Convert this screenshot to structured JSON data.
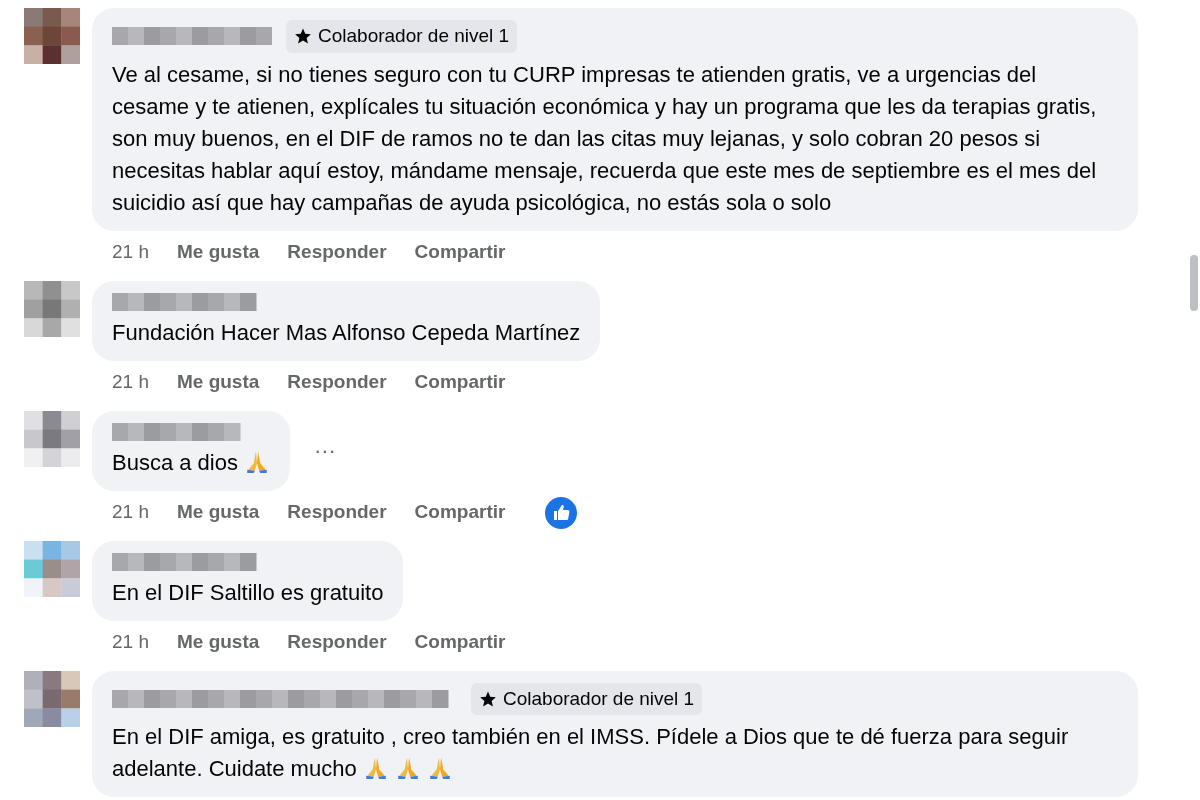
{
  "comments": [
    {
      "badge": {
        "label": "Colaborador de nivel 1"
      },
      "text": "Ve al cesame, si no tienes seguro con tu CURP impresas te atienden gratis, ve a urgencias del cesame y te atienen, explícales tu situación económica y hay un programa que les da terapias gratis, son muy buenos, en el DIF de ramos no te dan las citas muy lejanas, y solo cobran 20 pesos si necesitas hablar aquí estoy, mándame mensaje, recuerda que este mes de septiembre es el mes del suicidio así que hay campañas de ayuda psicológica, no estás sola o solo",
      "time": "21 h",
      "actions": [
        "Me gusta",
        "Responder",
        "Compartir"
      ]
    },
    {
      "text": "Fundación Hacer Mas Alfonso Cepeda Martínez",
      "time": "21 h",
      "actions": [
        "Me gusta",
        "Responder",
        "Compartir"
      ]
    },
    {
      "text": "Busca a dios",
      "emojis": [
        {
          "kind": "praying-hands"
        }
      ],
      "more": "···",
      "reaction": {
        "kind": "like"
      },
      "time": "21 h",
      "actions": [
        "Me gusta",
        "Responder",
        "Compartir"
      ]
    },
    {
      "text": "En el DIF Saltillo es gratuito",
      "time": "21 h",
      "actions": [
        "Me gusta",
        "Responder",
        "Compartir"
      ]
    },
    {
      "badge": {
        "label": "Colaborador de nivel 1"
      },
      "text": "En el DIF amiga, es gratuito , creo también en el IMSS. Pídele a Dios que te dé fuerza para seguir adelante. Cuidate mucho",
      "emojis": [
        {
          "kind": "praying-hands"
        },
        {
          "kind": "praying-hands"
        },
        {
          "kind": "praying-hands"
        }
      ]
    }
  ]
}
